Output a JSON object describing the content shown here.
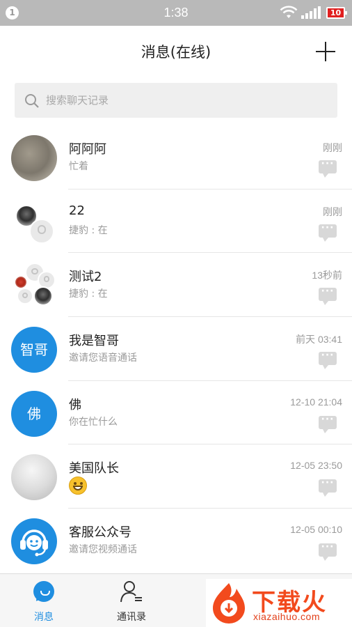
{
  "status_bar": {
    "notification_count": "1",
    "time": "1:38",
    "battery": "10",
    "icons": [
      "wifi-icon",
      "signal-icon",
      "battery-icon"
    ]
  },
  "header": {
    "title": "消息(在线)",
    "add_icon": "plus-icon"
  },
  "search": {
    "placeholder": "搜索聊天记录",
    "icon": "search-icon"
  },
  "conversations": [
    {
      "name": "阿阿阿",
      "preview": "忙着",
      "time": "刚刚",
      "avatar": "photo"
    },
    {
      "name": "22",
      "preview": "捷豹 : 在",
      "time": "刚刚",
      "avatar": "group"
    },
    {
      "name": "测试2",
      "preview": "捷豹 : 在",
      "time": "13秒前",
      "avatar": "group"
    },
    {
      "name": "我是智哥",
      "preview": "邀请您语音通话",
      "time": "前天 03:41",
      "avatar": "text",
      "avatar_text": "智哥"
    },
    {
      "name": "佛",
      "preview": "你在忙什么",
      "time": "12-10 21:04",
      "avatar": "text",
      "avatar_text": "佛"
    },
    {
      "name": "美国队长",
      "preview": "",
      "preview_emoji": "smiley-icon",
      "time": "12-05 23:50",
      "avatar": "photo"
    },
    {
      "name": "客服公众号",
      "preview": "邀请您视频通话",
      "time": "12-05 00:10",
      "avatar": "headset-icon"
    }
  ],
  "tabs": [
    {
      "label": "消息",
      "icon": "chat-bubble-icon",
      "active": true
    },
    {
      "label": "通讯录",
      "icon": "contacts-icon",
      "active": false
    }
  ],
  "watermark": {
    "title": "下载火",
    "url": "xiazaihuo.com"
  },
  "colors": {
    "accent": "#1f8ee0",
    "status_bar": "#b9b9b9",
    "watermark": "#f24a1d"
  }
}
